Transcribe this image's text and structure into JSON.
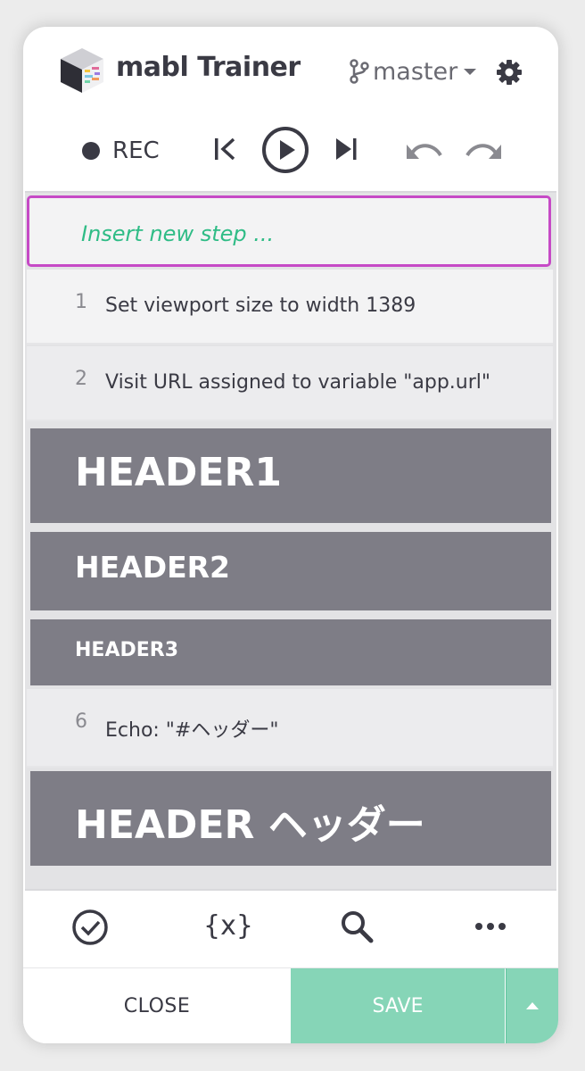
{
  "header": {
    "app_title": "mabl Trainer",
    "branch": "master"
  },
  "toolbar": {
    "rec_label": "REC"
  },
  "steps": {
    "insert_placeholder": "Insert new step ...",
    "items": [
      {
        "number": "1",
        "text": "Set viewport size to width 1389"
      },
      {
        "number": "2",
        "text": "Visit URL assigned to variable \"app.url\""
      },
      {
        "heading": "HEADER1"
      },
      {
        "heading": "HEADER2"
      },
      {
        "heading": "HEADER3"
      },
      {
        "number": "6",
        "text": "Echo: \"#ヘッダー\""
      },
      {
        "heading": "HEADER ヘッダー"
      }
    ]
  },
  "bottom_toolbar": {
    "variables_label": "{x}"
  },
  "footer": {
    "close_label": "CLOSE",
    "save_label": "SAVE"
  },
  "colors": {
    "accent_green": "#2fbc86",
    "save_button": "#86d5b7",
    "insert_border": "#c64ac6",
    "header_step_bg": "#7e7d86"
  }
}
